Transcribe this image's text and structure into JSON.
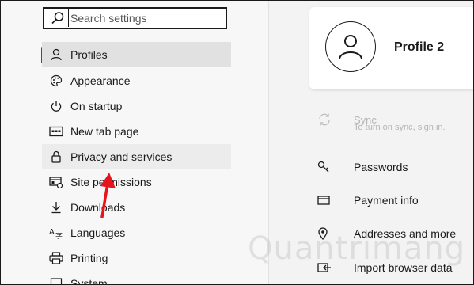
{
  "search": {
    "placeholder": "Search settings"
  },
  "sidebar": {
    "items": [
      {
        "label": "Profiles",
        "icon": "person-icon",
        "active": true
      },
      {
        "label": "Appearance",
        "icon": "palette-icon"
      },
      {
        "label": "On startup",
        "icon": "power-icon"
      },
      {
        "label": "New tab page",
        "icon": "new-tab-icon"
      },
      {
        "label": "Privacy and services",
        "icon": "lock-icon",
        "highlighted": true
      },
      {
        "label": "Site permissions",
        "icon": "site-permissions-icon"
      },
      {
        "label": "Downloads",
        "icon": "download-icon"
      },
      {
        "label": "Languages",
        "icon": "languages-icon"
      },
      {
        "label": "Printing",
        "icon": "printer-icon"
      },
      {
        "label": "System",
        "icon": "system-icon"
      }
    ]
  },
  "profile": {
    "name": "Profile 2"
  },
  "main": {
    "sync": {
      "label": "Sync",
      "subtitle": "To turn on sync, sign in."
    },
    "items": [
      {
        "label": "Passwords",
        "icon": "key-icon"
      },
      {
        "label": "Payment info",
        "icon": "card-icon"
      },
      {
        "label": "Addresses and more",
        "icon": "location-pin-icon"
      },
      {
        "label": "Import browser data",
        "icon": "import-icon"
      }
    ]
  },
  "watermark": "Quantrimang",
  "colors": {
    "accent": "#0f5ea8",
    "arrow": "#e8141b",
    "active_bg": "#e1e1e1"
  }
}
